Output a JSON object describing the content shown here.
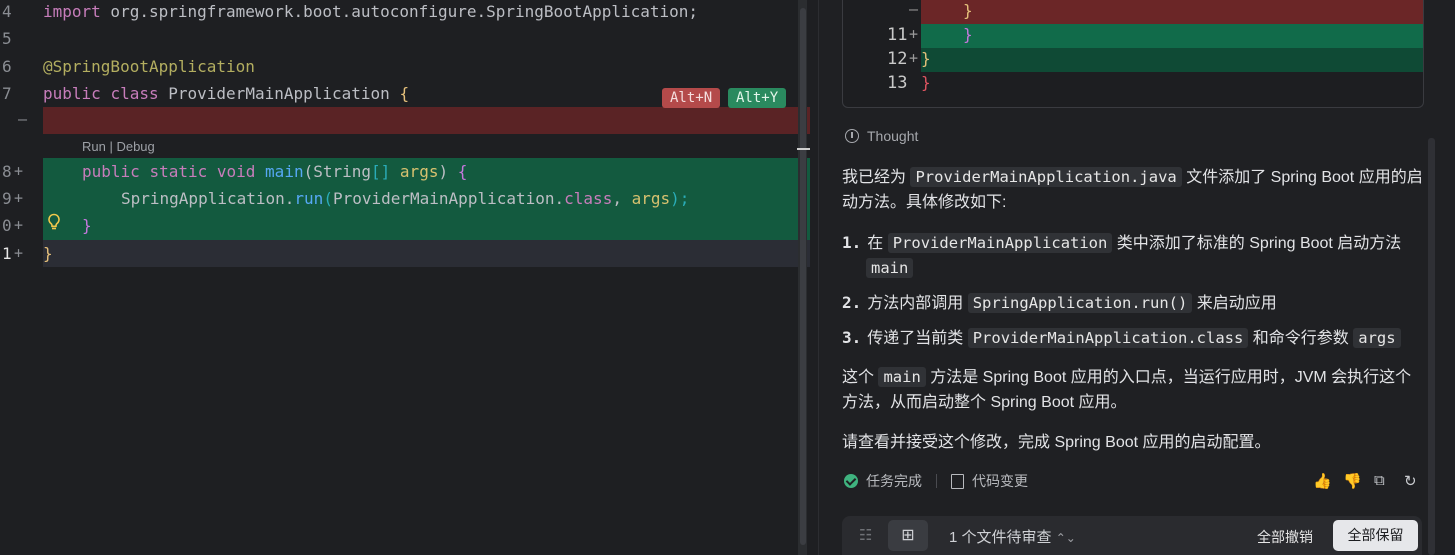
{
  "editor": {
    "gutter": {
      "l4": "4",
      "l5": "5",
      "l6": "6",
      "l7": "7",
      "removed_mark": "—",
      "l8": "8",
      "l9": "9",
      "l10": "0",
      "l11": "1",
      "plus": "+"
    },
    "code": {
      "import_kw": "import",
      "import_path": " org.springframework.boot.autoconfigure.SpringBootApplication;",
      "annotation": "@SpringBootApplication",
      "public_kw": "public",
      "class_kw": "class",
      "class_name": "ProviderMainApplication",
      "open_brace": "{",
      "main_public": "public",
      "main_static": "static",
      "main_void": "void",
      "main_name": "main",
      "main_params_open": "(",
      "main_param_type": "String",
      "main_param_arr": "[]",
      "main_param_name": "args",
      "main_params_close": ")",
      "main_brace": "{",
      "run_class": "SpringApplication",
      "run_dot": ".",
      "run_method": "run",
      "run_open": "(",
      "run_arg_class": "ProviderMainApplication",
      "run_arg_dot": ".",
      "run_arg_kw": "class",
      "run_comma": ", ",
      "run_arg_name": "args",
      "run_close": ");",
      "close_inner": "}",
      "close_outer": "}"
    },
    "codelens": "Run | Debug",
    "shortcuts": {
      "reject": "Alt+N",
      "accept": "Alt+Y"
    }
  },
  "diff": {
    "rows": [
      {
        "num": "",
        "mark": "—",
        "code": "}"
      },
      {
        "num": "11",
        "mark": "+",
        "code": "}"
      },
      {
        "num": "12",
        "mark": "+",
        "code": "}"
      },
      {
        "num": "13",
        "mark": "",
        "code": "}"
      }
    ]
  },
  "chat": {
    "thought_label": "Thought",
    "intro_pre": "我已经为 ",
    "intro_file": "ProviderMainApplication.java",
    "intro_post": " 文件添加了 Spring Boot 应用的启动方法。具体修改如下:",
    "items": [
      {
        "num": "1.",
        "pre": "在 ",
        "code": "ProviderMainApplication",
        "mid": " 类中添加了标准的 Spring Boot 启动方法 ",
        "code2": "main",
        "post": ""
      },
      {
        "num": "2.",
        "pre": "方法内部调用 ",
        "code": "SpringApplication.run()",
        "mid": " 来启动应用",
        "code2": "",
        "post": ""
      },
      {
        "num": "3.",
        "pre": "传递了当前类 ",
        "code": "ProviderMainApplication.class",
        "mid": " 和命令行参数 ",
        "code2": "args",
        "post": ""
      }
    ],
    "summary_pre": "这个 ",
    "summary_code": "main",
    "summary_post": " 方法是 Spring Boot 应用的入口点，当运行应用时，JVM 会执行这个方法，从而启动整个 Spring Boot 应用。",
    "closing": "请查看并接受这个修改，完成 Spring Boot 应用的启动配置。",
    "status_done": "任务完成",
    "status_changes": "代码变更",
    "feedback": {
      "like": "👍",
      "dislike": "👎",
      "copy": "⧉",
      "retry": "↻"
    }
  },
  "bottom_bar": {
    "list_icon": "☷",
    "review_icon": "⊞",
    "files_pending": "1 个文件待审查",
    "files_arrows": "⌃⌄",
    "undo_all": "全部撤销",
    "keep_all": "全部保留"
  }
}
